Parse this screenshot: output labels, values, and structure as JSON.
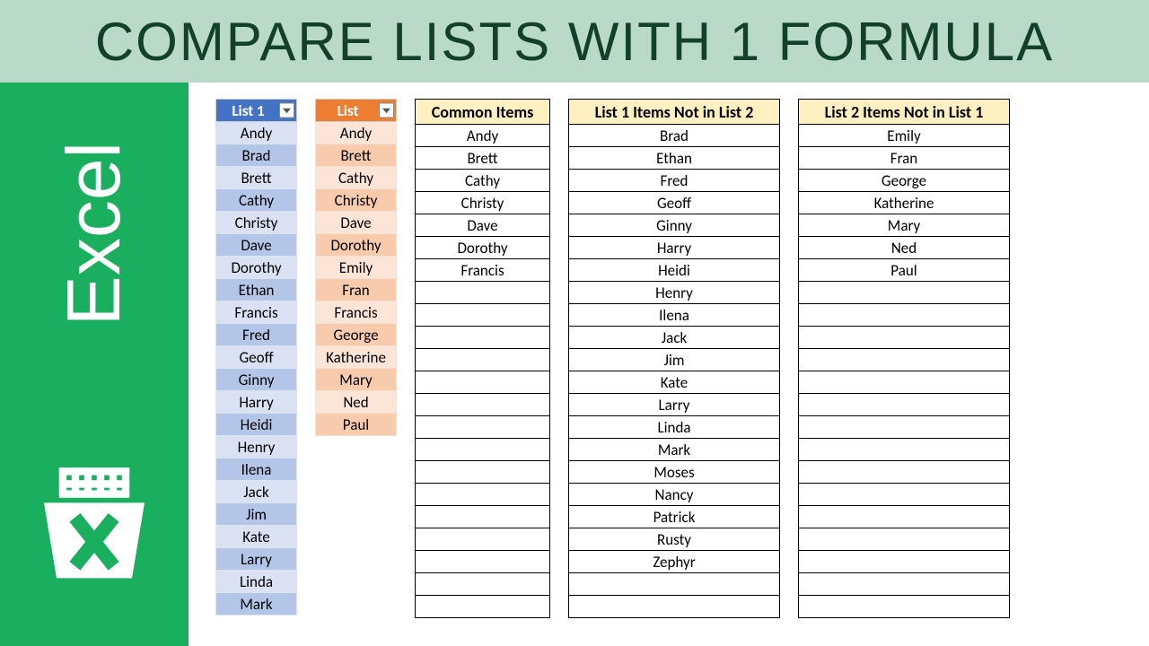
{
  "title": "Compare Lists with 1 formula",
  "sidebar_text": "Excel",
  "headers": {
    "list1": "List 1",
    "list2": "List",
    "common": "Common Items",
    "notin2": "List 1 Items Not in List 2",
    "notin1": "List 2 Items Not in List 1"
  },
  "list1": [
    "Andy",
    "Brad",
    "Brett",
    "Cathy",
    "Christy",
    "Dave",
    "Dorothy",
    "Ethan",
    "Francis",
    "Fred",
    "Geoff",
    "Ginny",
    "Harry",
    "Heidi",
    "Henry",
    "Ilena",
    "Jack",
    "Jim",
    "Kate",
    "Larry",
    "Linda",
    "Mark"
  ],
  "list2": [
    "Andy",
    "Brett",
    "Cathy",
    "Christy",
    "Dave",
    "Dorothy",
    "Emily",
    "Fran",
    "Francis",
    "George",
    "Katherine",
    "Mary",
    "Ned",
    "Paul"
  ],
  "common": [
    "Andy",
    "Brett",
    "Cathy",
    "Christy",
    "Dave",
    "Dorothy",
    "Francis",
    "",
    "",
    "",
    "",
    "",
    "",
    "",
    "",
    "",
    "",
    "",
    "",
    "",
    "",
    ""
  ],
  "notin2": [
    "Brad",
    "Ethan",
    "Fred",
    "Geoff",
    "Ginny",
    "Harry",
    "Heidi",
    "Henry",
    "Ilena",
    "Jack",
    "Jim",
    "Kate",
    "Larry",
    "Linda",
    "Mark",
    "Moses",
    "Nancy",
    "Patrick",
    "Rusty",
    "Zephyr",
    "",
    ""
  ],
  "notin1": [
    "Emily",
    "Fran",
    "George",
    "Katherine",
    "Mary",
    "Ned",
    "Paul",
    "",
    "",
    "",
    "",
    "",
    "",
    "",
    "",
    "",
    "",
    "",
    "",
    "",
    "",
    ""
  ]
}
